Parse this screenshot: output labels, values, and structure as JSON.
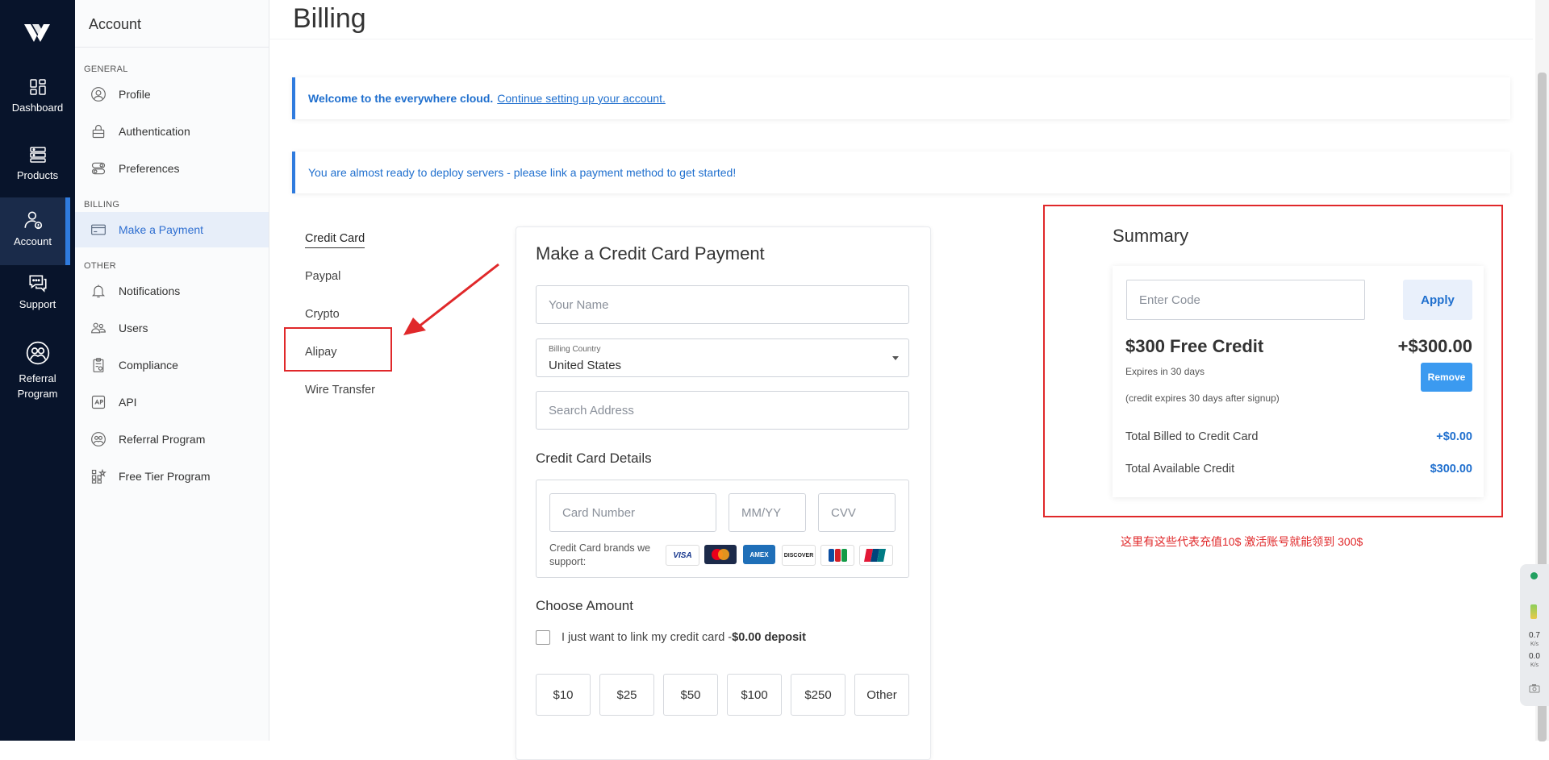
{
  "rail": {
    "items": [
      {
        "label": "Dashboard"
      },
      {
        "label": "Products"
      },
      {
        "label": "Account"
      },
      {
        "label": "Support"
      },
      {
        "label": "Referral Program"
      }
    ]
  },
  "sidebar": {
    "title": "Account",
    "sections": {
      "general": "GENERAL",
      "billing": "BILLING",
      "other": "OTHER"
    },
    "items": [
      {
        "label": "Profile",
        "icon": "profile-icon"
      },
      {
        "label": "Authentication",
        "icon": "lock-icon"
      },
      {
        "label": "Preferences",
        "icon": "toggle-icon"
      },
      {
        "label": "Make a Payment",
        "icon": "card-icon"
      },
      {
        "label": "Notifications",
        "icon": "bell-icon"
      },
      {
        "label": "Users",
        "icon": "users-icon"
      },
      {
        "label": "Compliance",
        "icon": "clipboard-icon"
      },
      {
        "label": "API",
        "icon": "api-icon"
      },
      {
        "label": "Referral Program",
        "icon": "referral-icon"
      },
      {
        "label": "Free Tier Program",
        "icon": "free-tier-icon"
      }
    ]
  },
  "main": {
    "title": "Billing",
    "alert1": {
      "bold": "Welcome to the everywhere cloud.",
      "link": "Continue setting up your account."
    },
    "alert2": {
      "text": "You are almost ready to deploy servers - please link a payment method to get started!"
    },
    "payment_tabs": [
      "Credit Card",
      "Paypal",
      "Crypto",
      "Alipay",
      "Wire Transfer"
    ]
  },
  "payment": {
    "title": "Make a Credit Card Payment",
    "name_placeholder": "Your Name",
    "country_label": "Billing Country",
    "country_value": "United States",
    "address_placeholder": "Search Address",
    "cc_title": "Credit Card Details",
    "card_number_placeholder": "Card Number",
    "expiry_placeholder": "MM/YY",
    "cvv_placeholder": "CVV",
    "brands_text": "Credit Card brands we support:",
    "brands": [
      "VISA",
      "MC",
      "AMEX",
      "DISCOVER",
      "JCB",
      "UnionPay"
    ],
    "amount_title": "Choose Amount",
    "link_only_text": "I just want to link my credit card -",
    "link_only_bold": "$0.00 deposit",
    "amounts": [
      "$10",
      "$25",
      "$50",
      "$100",
      "$250",
      "Other"
    ]
  },
  "summary": {
    "title": "Summary",
    "code_placeholder": "Enter Code",
    "apply_label": "Apply",
    "credit_title": "$300 Free Credit",
    "credit_amount": "+$300.00",
    "expires": "Expires in 30 days",
    "expires_note": "(credit expires 30 days after signup)",
    "remove_label": "Remove",
    "billed_label": "Total Billed to Credit Card",
    "billed_value": "+$0.00",
    "available_label": "Total Available Credit",
    "available_value": "$300.00"
  },
  "annotation": {
    "note": "这里有这些代表充值10$ 激活账号就能领到 300$"
  },
  "widget": {
    "up_value": "0.7",
    "up_unit": "K/s",
    "down_value": "0.0",
    "down_unit": "K/s"
  },
  "colors": {
    "rail_bg": "#08142b",
    "accent": "#2f7bde",
    "annotation_red": "#e0282a"
  }
}
